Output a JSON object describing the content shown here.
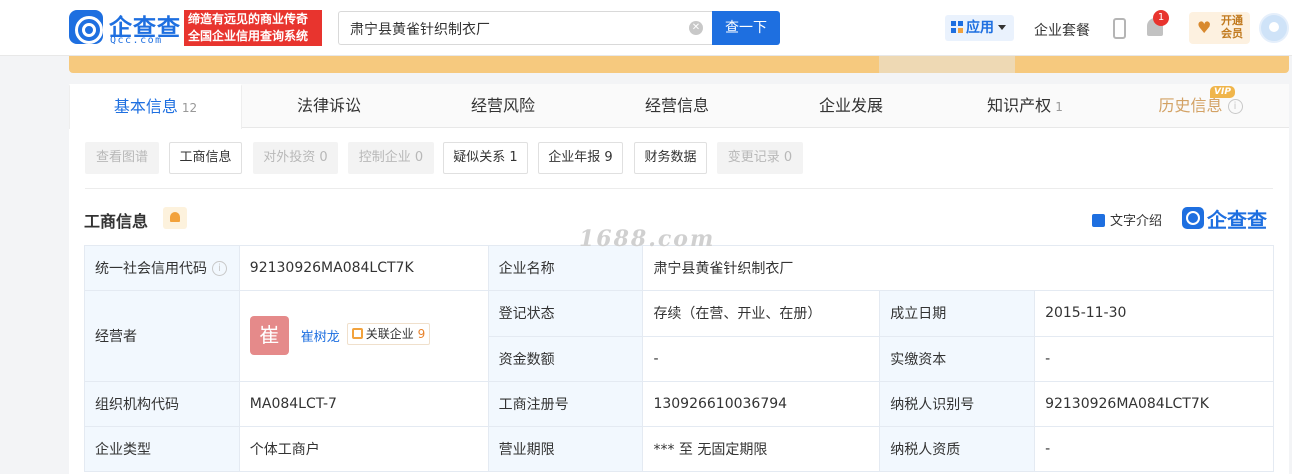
{
  "header": {
    "logo_cn": "企查查",
    "logo_en": "Qcc.com",
    "slogan_line1": "缔造有远见的商业传奇",
    "slogan_line2": "全国企业信用查询系统",
    "search_value": "肃宁县黄雀针织制衣厂",
    "search_button": "查一下",
    "apps_label": "应用",
    "package_label": "企业套餐",
    "notification_count": "1",
    "vip_line1": "开通",
    "vip_line2": "会员"
  },
  "tabs": [
    {
      "label": "基本信息",
      "count": "12"
    },
    {
      "label": "法律诉讼",
      "count": ""
    },
    {
      "label": "经营风险",
      "count": ""
    },
    {
      "label": "经营信息",
      "count": ""
    },
    {
      "label": "企业发展",
      "count": ""
    },
    {
      "label": "知识产权",
      "count": "1"
    },
    {
      "label": "历史信息",
      "count": ""
    }
  ],
  "vip_tag": "VIP",
  "subtabs": [
    {
      "label": "查看图谱",
      "disabled": true
    },
    {
      "label": "工商信息",
      "disabled": false
    },
    {
      "label": "对外投资 0",
      "disabled": true
    },
    {
      "label": "控制企业 0",
      "disabled": true
    },
    {
      "label": "疑似关系 1",
      "disabled": false
    },
    {
      "label": "企业年报 9",
      "disabled": false
    },
    {
      "label": "财务数据",
      "disabled": false
    },
    {
      "label": "变更记录 0",
      "disabled": true
    }
  ],
  "section": {
    "title": "工商信息",
    "text_intro": "文字介绍",
    "brand": "企查查"
  },
  "watermark": "1688.com",
  "info": {
    "credit_code_label": "统一社会信用代码",
    "credit_code": "92130926MA084LCT7K",
    "company_name_label": "企业名称",
    "company_name": "肃宁县黄雀针织制衣厂",
    "operator_label": "经营者",
    "operator_avatar": "崔",
    "operator_name": "崔树龙",
    "related_label": "关联企业",
    "related_count": "9",
    "reg_status_label": "登记状态",
    "reg_status": "存续（在营、开业、在册）",
    "established_label": "成立日期",
    "established": "2015-11-30",
    "capital_label": "资金数额",
    "capital": "-",
    "paid_capital_label": "实缴资本",
    "paid_capital": "-",
    "org_code_label": "组织机构代码",
    "org_code": "MA084LCT-7",
    "reg_no_label": "工商注册号",
    "reg_no": "130926610036794",
    "taxpayer_id_label": "纳税人识别号",
    "taxpayer_id": "92130926MA084LCT7K",
    "type_label": "企业类型",
    "type": "个体工商户",
    "term_label": "营业期限",
    "term": "*** 至 无固定期限",
    "taxpayer_qual_label": "纳税人资质",
    "taxpayer_qual": "-"
  }
}
